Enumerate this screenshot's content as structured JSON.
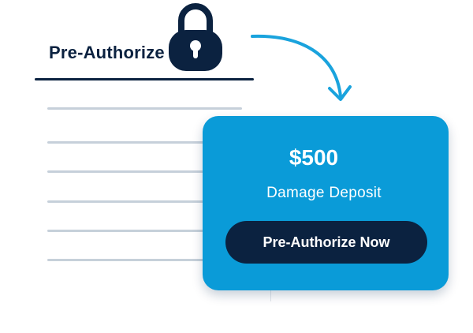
{
  "document": {
    "title": "Pre-Authorize"
  },
  "card": {
    "amount": "$500",
    "description": "Damage Deposit",
    "button_label": "Pre-Authorize Now"
  },
  "icons": {
    "lock": "lock-icon",
    "arrow": "curved-arrow-icon"
  },
  "colors": {
    "navy": "#0b2240",
    "card_blue": "#0a9bd8",
    "line_gray": "#c6d0da",
    "arrow_blue": "#1aa3dd"
  }
}
